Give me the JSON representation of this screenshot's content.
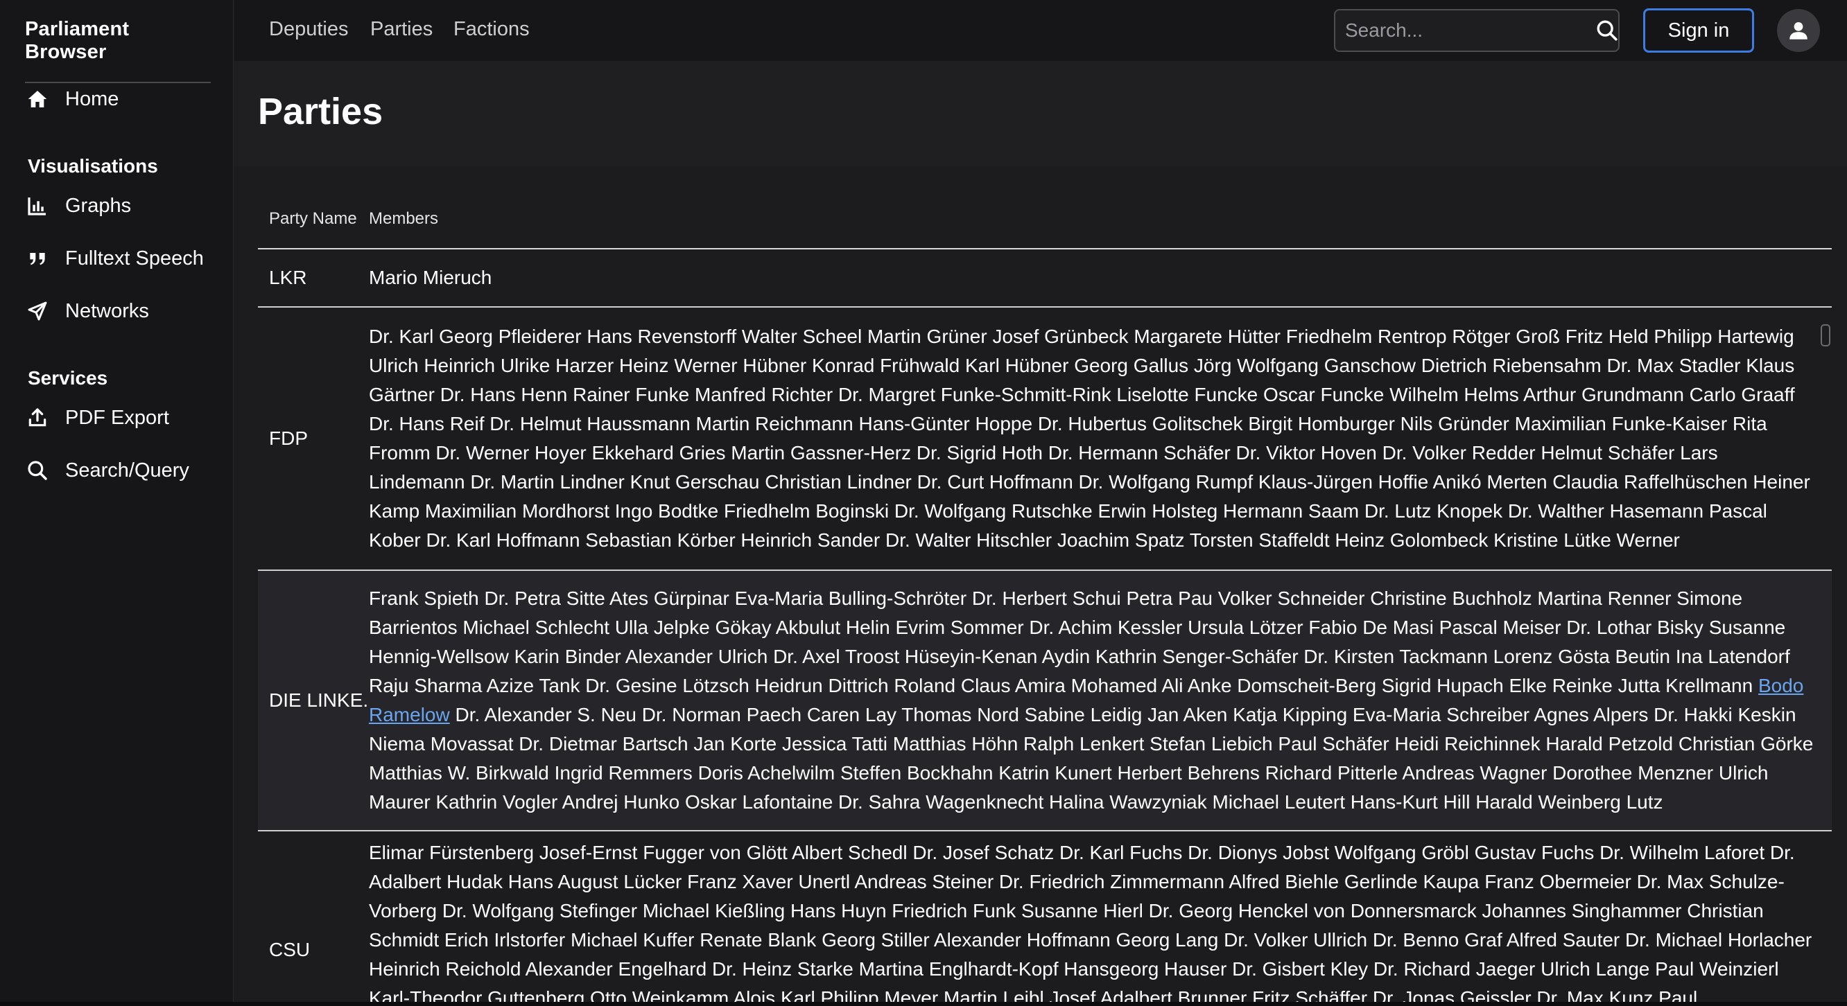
{
  "brand": "Parliament Browser",
  "sidebar": {
    "home": {
      "label": "Home",
      "icon": "home-icon"
    },
    "visualisations_title": "Visualisations",
    "visualisations": [
      {
        "label": "Graphs",
        "icon": "bar-chart-icon"
      },
      {
        "label": "Fulltext Speech",
        "icon": "quote-icon"
      },
      {
        "label": "Networks",
        "icon": "send-arrow-icon"
      }
    ],
    "services_title": "Services",
    "services": [
      {
        "label": "PDF Export",
        "icon": "upload-icon"
      },
      {
        "label": "Search/Query",
        "icon": "search-icon"
      }
    ]
  },
  "topnav": {
    "links": [
      "Deputies",
      "Parties",
      "Factions"
    ],
    "search_placeholder": "Search...",
    "sign_in": "Sign in"
  },
  "page": {
    "title": "Parties"
  },
  "table": {
    "headers": [
      "Party Name",
      "Members"
    ],
    "rows": [
      {
        "party": "LKR",
        "members": "Mario Mieruch"
      },
      {
        "party": "FDP",
        "members": "Dr. Karl Georg Pfleiderer Hans Revenstorff Walter Scheel Martin Grüner Josef Grünbeck Margarete Hütter Friedhelm Rentrop Rötger Groß Fritz Held Philipp Hartewig Ulrich Heinrich Ulrike Harzer Heinz Werner Hübner Konrad Frühwald Karl Hübner Georg Gallus Jörg Wolfgang Ganschow Dietrich Riebensahm Dr. Max Stadler Klaus Gärtner Dr. Hans Henn Rainer Funke Manfred Richter Dr. Margret Funke-Schmitt-Rink Liselotte Funcke Oscar Funcke Wilhelm Helms Arthur Grundmann Carlo Graaff Dr. Hans Reif Dr. Helmut Haussmann Martin Reichmann Hans-Günter Hoppe Dr. Hubertus Golitschek Birgit Homburger Nils Gründer Maximilian Funke-Kaiser Rita Fromm Dr. Werner Hoyer Ekkehard Gries Martin Gassner-Herz Dr. Sigrid Hoth Dr. Hermann Schäfer Dr. Viktor Hoven Dr. Volker Redder Helmut Schäfer Lars Lindemann Dr. Martin Lindner Knut Gerschau Christian Lindner Dr. Curt Hoffmann Dr. Wolfgang Rumpf Klaus-Jürgen Hoffie Anikó Merten Claudia Raffelhüschen Heiner Kamp Maximilian Mordhorst Ingo Bodtke Friedhelm Boginski Dr. Wolfgang Rutschke Erwin Holsteg Hermann Saam Dr. Lutz Knopek Dr. Walther Hasemann Pascal Kober Dr. Karl Hoffmann Sebastian Körber Heinrich Sander Dr. Walter Hitschler Joachim Spatz Torsten Staffeldt Heinz Golombeck Kristine Lütke Werner"
      },
      {
        "party": "DIE LINKE.",
        "members_before": "Frank Spieth Dr. Petra Sitte Ates Gürpinar Eva-Maria Bulling-Schröter Dr. Herbert Schui Petra Pau Volker Schneider Christine Buchholz Martina Renner Simone Barrientos Michael Schlecht Ulla Jelpke Gökay Akbulut Helin Evrim Sommer Dr. Achim Kessler Ursula Lötzer Fabio De Masi Pascal Meiser Dr. Lothar Bisky Susanne Hennig-Wellsow Karin Binder Alexander Ulrich Dr. Axel Troost Hüseyin-Kenan Aydin Kathrin Senger-Schäfer Dr. Kirsten Tackmann Lorenz Gösta Beutin Ina Latendorf Raju Sharma Azize Tank Dr. Gesine Lötzsch Heidrun Dittrich Roland Claus Amira Mohamed Ali Anke Domscheit-Berg Sigrid Hupach Elke Reinke Jutta Krellmann",
        "members_link": "Bodo Ramelow",
        "members_after": " Dr. Alexander S. Neu Dr. Norman Paech Caren Lay Thomas Nord Sabine Leidig Jan Aken Katja Kipping Eva-Maria Schreiber Agnes Alpers Dr. Hakki Keskin Niema Movassat Dr. Dietmar Bartsch Jan Korte Jessica Tatti Matthias Höhn Ralph Lenkert Stefan Liebich Paul Schäfer Heidi Reichinnek Harald Petzold Christian Görke Matthias W. Birkwald Ingrid Remmers Doris Achelwilm Steffen Bockhahn Katrin Kunert Herbert Behrens Richard Pitterle Andreas Wagner Dorothee Menzner Ulrich Maurer Kathrin Vogler Andrej Hunko Oskar Lafontaine Dr. Sahra Wagenknecht Halina Wawzyniak Michael Leutert Hans-Kurt Hill Harald Weinberg Lutz"
      },
      {
        "party": "CSU",
        "members": "Elimar Fürstenberg Josef-Ernst Fugger von Glött Albert Schedl Dr. Josef Schatz Dr. Karl Fuchs Dr. Dionys Jobst Wolfgang Gröbl Gustav Fuchs Dr. Wilhelm Laforet Dr. Adalbert Hudak Hans August Lücker Franz Xaver Unertl Andreas Steiner Dr. Friedrich Zimmermann Alfred Biehle Gerlinde Kaupa Franz Obermeier Dr. Max Schulze-Vorberg Dr. Wolfgang Stefinger Michael Kießling Hans Huyn Friedrich Funk Susanne Hierl Dr. Georg Henckel von Donnersmarck Johannes Singhammer Christian Schmidt Erich Irlstorfer Michael Kuffer Renate Blank Georg Stiller Alexander Hoffmann Georg Lang Dr. Volker Ullrich Dr. Benno Graf Alfred Sauter Dr. Michael Horlacher Heinrich Reichold Alexander Engelhard Dr. Heinz Starke Martina Englhardt-Kopf Hansgeorg Hauser Dr. Gisbert Kley Dr. Richard Jaeger Ulrich Lange Paul Weinzierl Karl-Theodor Guttenberg Otto Weinkamm Alois Karl Philipp Meyer Martin Leibl Josef Adalbert Brunner Fritz Schäffer Dr. Jonas Geissler Dr. Max Kunz Paul"
      }
    ]
  }
}
